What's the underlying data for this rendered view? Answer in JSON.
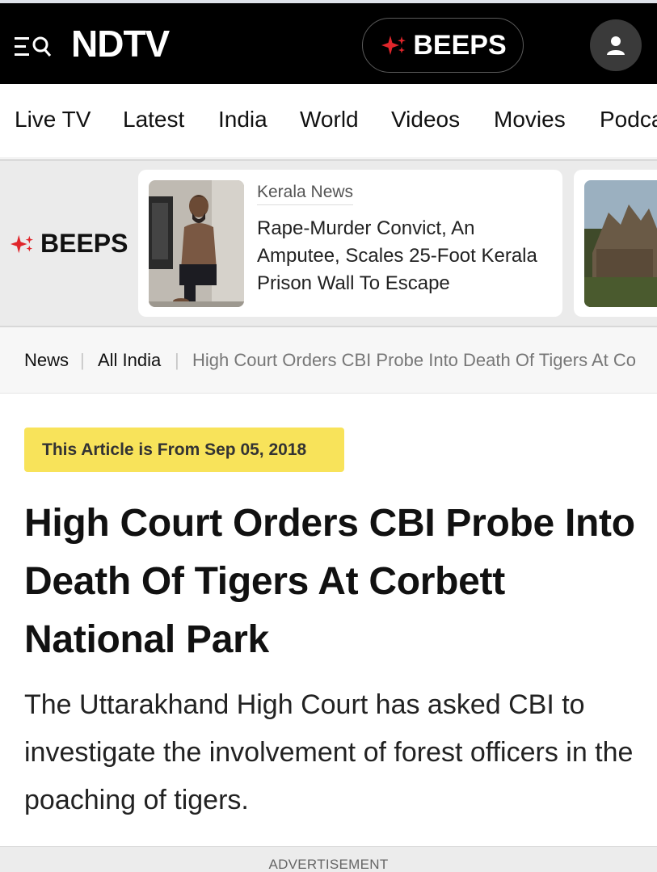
{
  "header": {
    "logo_text": "NDTV",
    "beeps_label": "BEEPS",
    "colors": {
      "background": "#000000",
      "accent": "#e0262b"
    }
  },
  "nav": {
    "items": [
      "Live TV",
      "Latest",
      "India",
      "World",
      "Videos",
      "Movies",
      "Podca"
    ]
  },
  "beeps_strip": {
    "label": "BEEPS",
    "card": {
      "category": "Kerala News",
      "title": "Rape-Murder Convict, An Amputee, Scales 25-Foot Kerala Prison Wall To Escape"
    }
  },
  "breadcrumb": {
    "items": [
      "News",
      "All India",
      "High Court Orders CBI Probe Into Death Of Tigers At Co"
    ]
  },
  "article": {
    "date_badge": "This Article is From Sep 05, 2018",
    "headline": "High Court Orders CBI Probe Into Death Of Tigers At Corbett National Park",
    "summary": "The Uttarakhand High Court has asked CBI to investigate the involvement of forest officers in the poaching of tigers."
  },
  "ad": {
    "label": "ADVERTISEMENT"
  }
}
